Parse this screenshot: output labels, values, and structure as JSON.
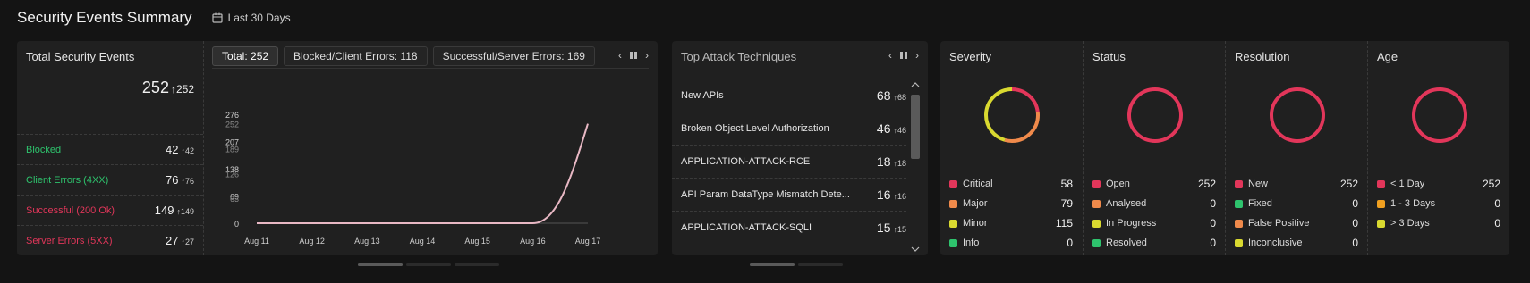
{
  "header": {
    "title": "Security Events Summary",
    "date_range": "Last 30 Days"
  },
  "total_card": {
    "title": "Total Security Events",
    "total": "252",
    "total_delta": "252",
    "rows": [
      {
        "label": "Blocked",
        "value": "42",
        "delta": "42",
        "color": "#2ec36d"
      },
      {
        "label": "Client Errors (4XX)",
        "value": "76",
        "delta": "76",
        "color": "#2ec36d"
      },
      {
        "label": "Successful (200 Ok)",
        "value": "149",
        "delta": "149",
        "color": "#e2365a"
      },
      {
        "label": "Server Errors (5XX)",
        "value": "27",
        "delta": "27",
        "color": "#e2365a"
      }
    ],
    "tabs": [
      "Total: 252",
      "Blocked/Client Errors: 118",
      "Successful/Server Errors: 169"
    ],
    "active_tab": 0
  },
  "chart_data": {
    "type": "line",
    "x": [
      "Aug 11",
      "Aug 12",
      "Aug 13",
      "Aug 14",
      "Aug 15",
      "Aug 16",
      "Aug 17"
    ],
    "series": [
      {
        "values": [
          0,
          0,
          0,
          0,
          0,
          0,
          252
        ],
        "color": "#e8b8c4"
      }
    ],
    "yticks": [
      "0",
      "69",
      "138",
      "207",
      "276"
    ],
    "yticks_overlay": [
      "63",
      "126",
      "189",
      "252"
    ],
    "ylim": [
      0,
      276
    ]
  },
  "attack_card": {
    "title": "Top Attack Techniques",
    "items": [
      {
        "name": "New APIs",
        "value": "68",
        "delta": "68"
      },
      {
        "name": "Broken Object Level Authorization",
        "value": "46",
        "delta": "46"
      },
      {
        "name": "APPLICATION-ATTACK-RCE",
        "value": "18",
        "delta": "18"
      },
      {
        "name": "API Param DataType Mismatch Dete...",
        "value": "16",
        "delta": "16"
      },
      {
        "name": "APPLICATION-ATTACK-SQLI",
        "value": "15",
        "delta": "15"
      }
    ]
  },
  "stats": [
    {
      "title": "Severity",
      "items": [
        {
          "label": "Critical",
          "value": "58",
          "color": "#e2365a"
        },
        {
          "label": "Major",
          "value": "79",
          "color": "#f08a4b"
        },
        {
          "label": "Minor",
          "value": "115",
          "color": "#d9d930"
        },
        {
          "label": "Info",
          "value": "0",
          "color": "#2ec36d"
        }
      ]
    },
    {
      "title": "Status",
      "items": [
        {
          "label": "Open",
          "value": "252",
          "color": "#e2365a"
        },
        {
          "label": "Analysed",
          "value": "0",
          "color": "#f08a4b"
        },
        {
          "label": "In Progress",
          "value": "0",
          "color": "#d9d930"
        },
        {
          "label": "Resolved",
          "value": "0",
          "color": "#2ec36d"
        }
      ]
    },
    {
      "title": "Resolution",
      "items": [
        {
          "label": "New",
          "value": "252",
          "color": "#e2365a"
        },
        {
          "label": "Fixed",
          "value": "0",
          "color": "#2ec36d"
        },
        {
          "label": "False Positive",
          "value": "0",
          "color": "#f08a4b"
        },
        {
          "label": "Inconclusive",
          "value": "0",
          "color": "#d9d930"
        }
      ]
    },
    {
      "title": "Age",
      "items": [
        {
          "label": "< 1 Day",
          "value": "252",
          "color": "#e2365a"
        },
        {
          "label": "1 - 3 Days",
          "value": "0",
          "color": "#f0a020"
        },
        {
          "label": "> 3 Days",
          "value": "0",
          "color": "#d9d930"
        }
      ]
    }
  ],
  "icons": {
    "calendar": "calendar-icon",
    "prev": "chevron-left-icon",
    "pause": "pause-icon",
    "next": "chevron-right-icon"
  }
}
